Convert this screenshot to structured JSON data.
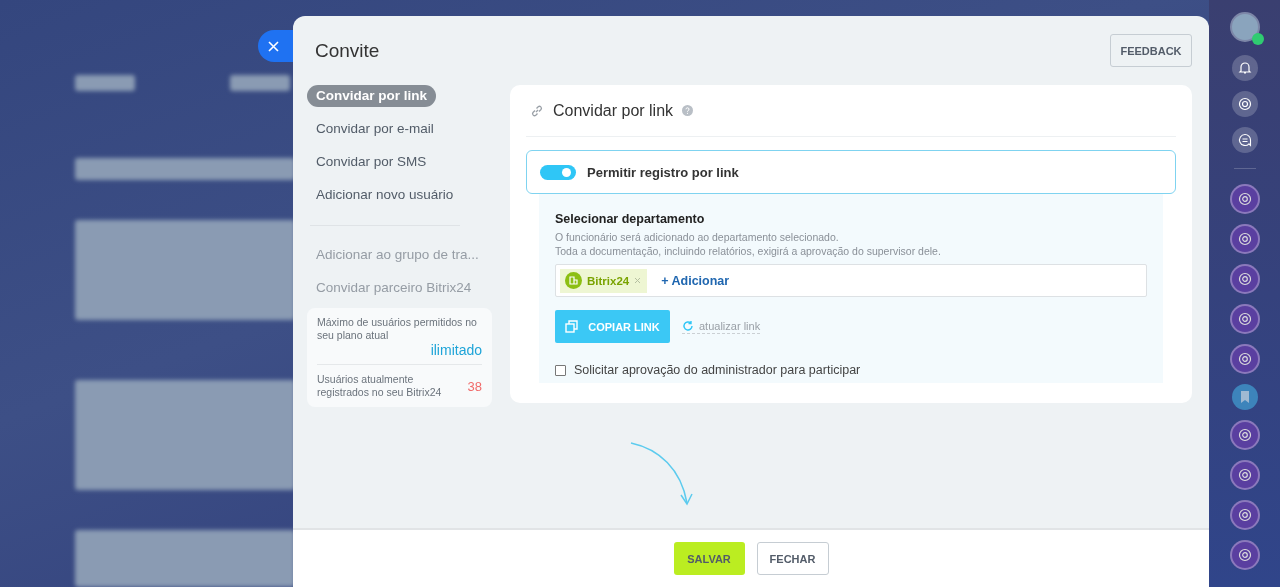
{
  "window": {
    "title": "Convite"
  },
  "feedback_button": "FEEDBACK",
  "nav": {
    "primary": [
      {
        "label": "Convidar por link",
        "selected": true
      },
      {
        "label": "Convidar por e-mail",
        "selected": false
      },
      {
        "label": "Convidar por SMS",
        "selected": false
      },
      {
        "label": "Adicionar novo usuário",
        "selected": false
      }
    ],
    "secondary": [
      {
        "label": "Adicionar ao grupo de tra...",
        "selected": false
      },
      {
        "label": "Convidar parceiro Bitrix24",
        "selected": false
      }
    ]
  },
  "stats": [
    {
      "label": "Máximo de usuários permitidos no seu plano atual",
      "value": "ilimitado",
      "kind": "unlimited"
    },
    {
      "label": "Usuários atualmente registrados no seu Bitrix24",
      "value": "38",
      "kind": "count"
    }
  ],
  "card": {
    "title": "Convidar por link",
    "toggle": {
      "label": "Permitir registro por link",
      "on": true
    },
    "department": {
      "title": "Selecionar departamento",
      "description": [
        "O funcionário será adicionado ao departamento selecionado.",
        "Toda a documentação, incluindo relatórios, exigirá a aprovação do supervisor dele."
      ],
      "tags": [
        {
          "label": "Bitrix24"
        }
      ],
      "add_link": "+ Adicionar"
    },
    "copy_button": "COPIAR LINK",
    "refresh_link": "atualizar link",
    "checkbox": {
      "label": "Solicitar aprovação do administrador para participar",
      "checked": false
    }
  },
  "footer": {
    "buttons": [
      {
        "label": "SALVAR",
        "kind": "primary"
      },
      {
        "label": "FECHAR",
        "kind": "secondary"
      }
    ]
  }
}
